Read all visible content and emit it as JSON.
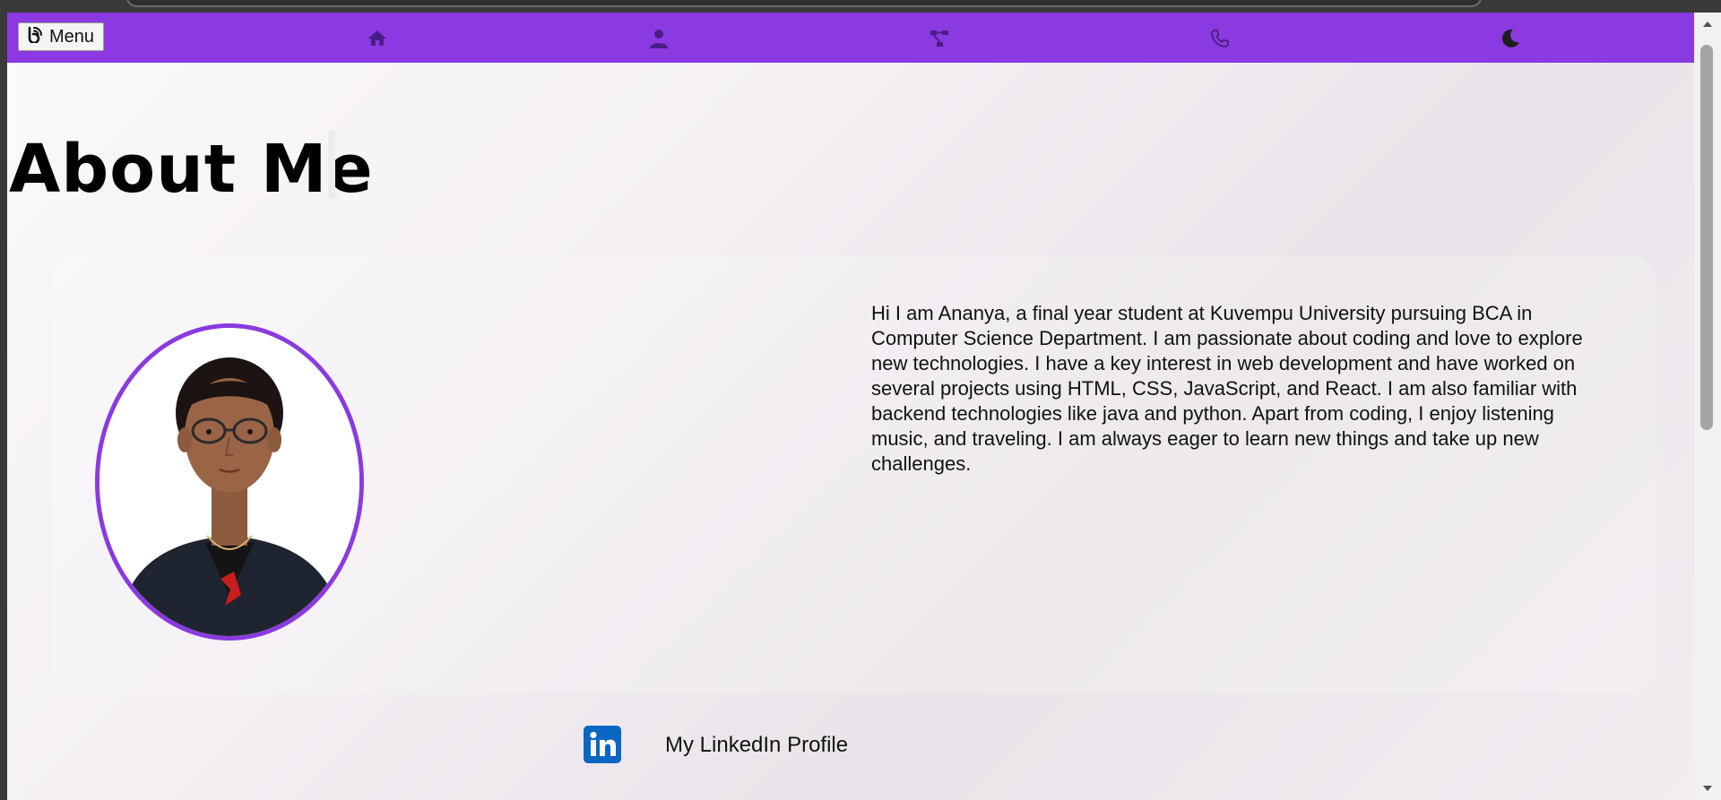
{
  "navbar": {
    "menu_label": "Menu",
    "icons": [
      "home-icon",
      "user-icon",
      "sitemap-icon",
      "phone-icon",
      "moon-icon"
    ],
    "background": "#8a3ae0"
  },
  "about": {
    "heading": "About Me",
    "bio": "Hi I am Ananya, a final year student at Kuvempu University pursuing BCA in Computer Science Department. I am passionate about coding and love to explore new technologies. I have a key interest in web development and have worked on several projects using HTML, CSS, JavaScript, and React. I am also familiar with backend technologies like java and python. Apart from coding, I enjoy listening music, and traveling. I am always eager to learn new things and take up new challenges.",
    "photo_icon": "profile-photo",
    "accent_color": "#8a3ae0"
  },
  "social": {
    "linkedin_label": "My LinkedIn Profile",
    "linkedin_icon": "linkedin-icon",
    "linkedin_color": "#0a66c2"
  }
}
